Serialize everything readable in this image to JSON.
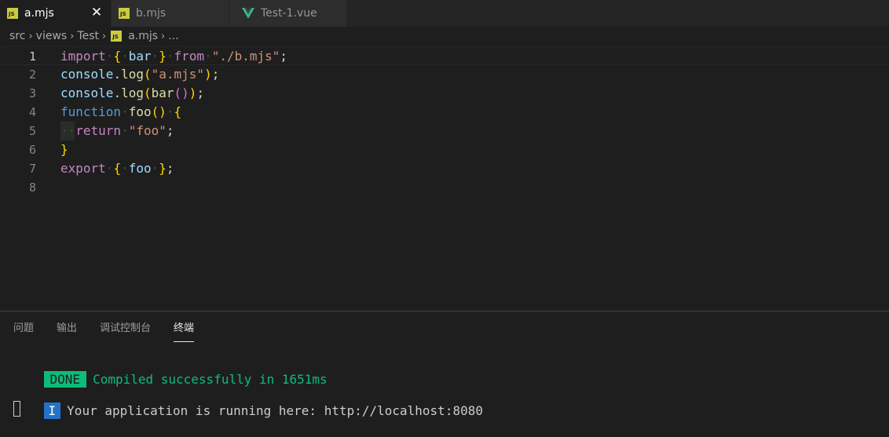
{
  "tabs": [
    {
      "icon": "js-file-icon",
      "icon_text": "JS",
      "label": "a.mjs",
      "active": true,
      "close": "✕"
    },
    {
      "icon": "js-file-icon",
      "icon_text": "JS",
      "label": "b.mjs",
      "active": false
    },
    {
      "icon": "vue-file-icon",
      "label": "Test-1.vue",
      "active": false
    }
  ],
  "breadcrumb": {
    "items": [
      "src",
      "views",
      "Test",
      "a.mjs",
      "..."
    ],
    "separator": "›",
    "file_icon_text": "JS"
  },
  "editor": {
    "line_numbers": [
      "1",
      "2",
      "3",
      "4",
      "5",
      "6",
      "7",
      "8"
    ],
    "current_line": 1,
    "tokens": {
      "l1_import": "import",
      "l1_brace_open": "{",
      "l1_bar": "bar",
      "l1_brace_close": "}",
      "l1_from": "from",
      "l1_path": "\"./b.mjs\"",
      "l1_semi": ";",
      "l2_console": "console",
      "l2_dot": ".",
      "l2_log": "log",
      "l2_paren_open": "(",
      "l2_str": "\"a.mjs\"",
      "l2_paren_close": ")",
      "l2_semi": ";",
      "l3_console": "console",
      "l3_dot": ".",
      "l3_log": "log",
      "l3_paren_open": "(",
      "l3_bar": "bar",
      "l3_inner_parens": "()",
      "l3_paren_close": ")",
      "l3_semi": ";",
      "l4_function": "function",
      "l4_foo": "foo",
      "l4_parens": "()",
      "l4_brace": "{",
      "l5_return": "return",
      "l5_str": "\"foo\"",
      "l5_semi": ";",
      "l6_brace": "}",
      "l7_export": "export",
      "l7_brace_open": "{",
      "l7_foo": "foo",
      "l7_brace_close": "}",
      "l7_semi": ";"
    }
  },
  "panel": {
    "tabs": [
      "问题",
      "输出",
      "调试控制台",
      "终端"
    ],
    "active_tab": "终端",
    "terminal": {
      "done_badge": "DONE",
      "done_message": "Compiled successfully in 1651ms",
      "info_badge": "I",
      "info_message": "Your application is running here: http://localhost:8080"
    }
  },
  "colors": {
    "js_icon": "#cbcb41",
    "vue_icon": "#41b883",
    "done_green": "#0dbc79",
    "info_blue": "#2472c8"
  }
}
